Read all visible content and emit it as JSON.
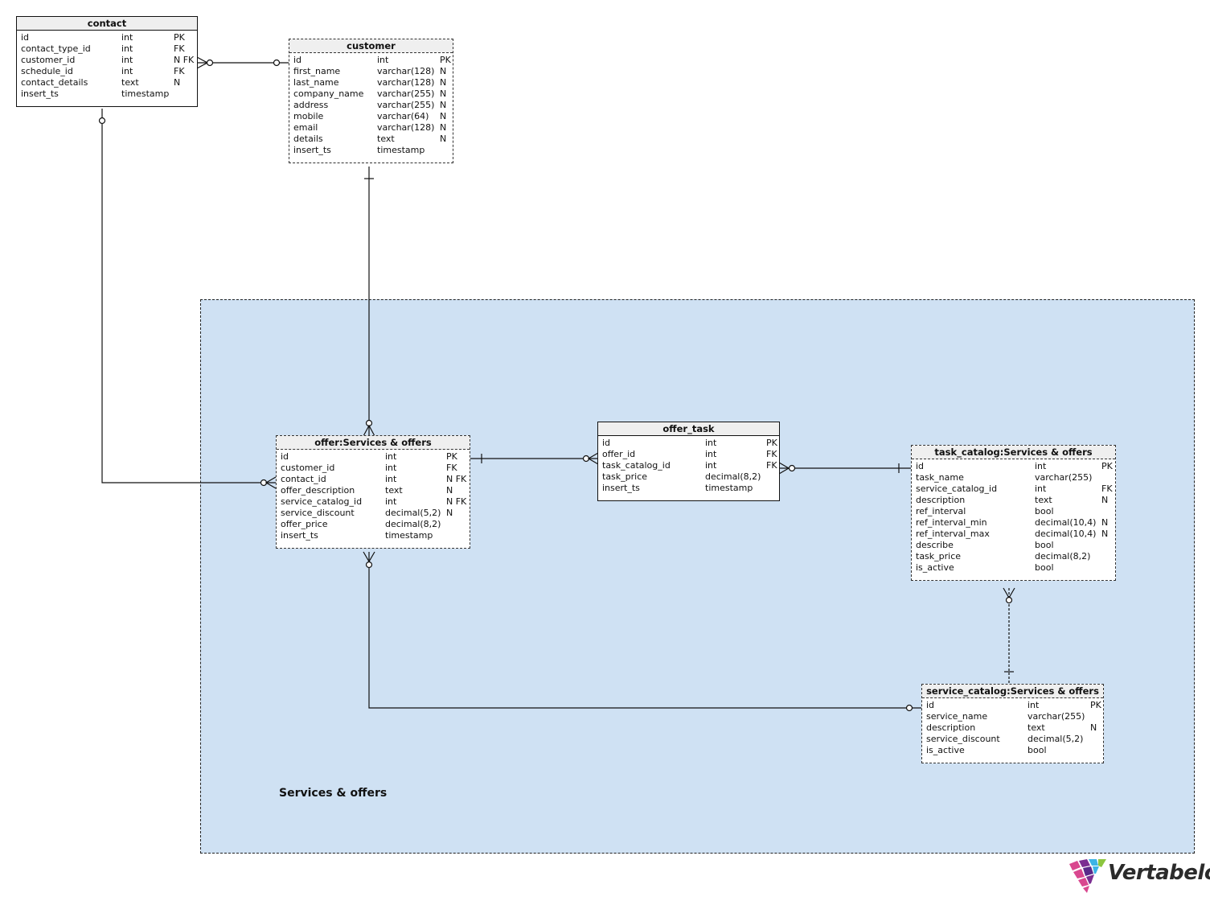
{
  "subject_area": {
    "label": "Services & offers",
    "fill_color": "#cfe1f3"
  },
  "tables": {
    "contact": {
      "title": "contact",
      "columns": [
        {
          "name": "id",
          "type": "int",
          "flags": "PK"
        },
        {
          "name": "contact_type_id",
          "type": "int",
          "flags": "FK"
        },
        {
          "name": "customer_id",
          "type": "int",
          "flags": "N FK"
        },
        {
          "name": "schedule_id",
          "type": "int",
          "flags": "FK"
        },
        {
          "name": "contact_details",
          "type": "text",
          "flags": "N"
        },
        {
          "name": "insert_ts",
          "type": "timestamp",
          "flags": ""
        }
      ]
    },
    "customer": {
      "title": "customer",
      "columns": [
        {
          "name": "id",
          "type": "int",
          "flags": "PK"
        },
        {
          "name": "first_name",
          "type": "varchar(128)",
          "flags": "N"
        },
        {
          "name": "last_name",
          "type": "varchar(128)",
          "flags": "N"
        },
        {
          "name": "company_name",
          "type": "varchar(255)",
          "flags": "N"
        },
        {
          "name": "address",
          "type": "varchar(255)",
          "flags": "N"
        },
        {
          "name": "mobile",
          "type": "varchar(64)",
          "flags": "N"
        },
        {
          "name": "email",
          "type": "varchar(128)",
          "flags": "N"
        },
        {
          "name": "details",
          "type": "text",
          "flags": "N"
        },
        {
          "name": "insert_ts",
          "type": "timestamp",
          "flags": ""
        }
      ]
    },
    "offer": {
      "title": "offer:Services & offers",
      "columns": [
        {
          "name": "id",
          "type": "int",
          "flags": "PK"
        },
        {
          "name": "customer_id",
          "type": "int",
          "flags": "FK"
        },
        {
          "name": "contact_id",
          "type": "int",
          "flags": "N FK"
        },
        {
          "name": "offer_description",
          "type": "text",
          "flags": "N"
        },
        {
          "name": "service_catalog_id",
          "type": "int",
          "flags": "N FK"
        },
        {
          "name": "service_discount",
          "type": "decimal(5,2)",
          "flags": "N"
        },
        {
          "name": "offer_price",
          "type": "decimal(8,2)",
          "flags": ""
        },
        {
          "name": "insert_ts",
          "type": "timestamp",
          "flags": ""
        }
      ]
    },
    "offer_task": {
      "title": "offer_task",
      "columns": [
        {
          "name": "id",
          "type": "int",
          "flags": "PK"
        },
        {
          "name": "offer_id",
          "type": "int",
          "flags": "FK"
        },
        {
          "name": "task_catalog_id",
          "type": "int",
          "flags": "FK"
        },
        {
          "name": "task_price",
          "type": "decimal(8,2)",
          "flags": ""
        },
        {
          "name": "insert_ts",
          "type": "timestamp",
          "flags": ""
        }
      ]
    },
    "task_catalog": {
      "title": "task_catalog:Services & offers",
      "columns": [
        {
          "name": "id",
          "type": "int",
          "flags": "PK"
        },
        {
          "name": "task_name",
          "type": "varchar(255)",
          "flags": ""
        },
        {
          "name": "service_catalog_id",
          "type": "int",
          "flags": "FK"
        },
        {
          "name": "description",
          "type": "text",
          "flags": "N"
        },
        {
          "name": "ref_interval",
          "type": "bool",
          "flags": ""
        },
        {
          "name": "ref_interval_min",
          "type": "decimal(10,4)",
          "flags": "N"
        },
        {
          "name": "ref_interval_max",
          "type": "decimal(10,4)",
          "flags": "N"
        },
        {
          "name": "describe",
          "type": "bool",
          "flags": ""
        },
        {
          "name": "task_price",
          "type": "decimal(8,2)",
          "flags": ""
        },
        {
          "name": "is_active",
          "type": "bool",
          "flags": ""
        }
      ]
    },
    "service_catalog": {
      "title": "service_catalog:Services & offers",
      "columns": [
        {
          "name": "id",
          "type": "int",
          "flags": "PK"
        },
        {
          "name": "service_name",
          "type": "varchar(255)",
          "flags": ""
        },
        {
          "name": "description",
          "type": "text",
          "flags": "N"
        },
        {
          "name": "service_discount",
          "type": "decimal(5,2)",
          "flags": ""
        },
        {
          "name": "is_active",
          "type": "bool",
          "flags": ""
        }
      ]
    }
  },
  "relationships": [
    {
      "from": "contact",
      "to": "customer",
      "from_end": "zero-or-many",
      "to_end": "zero-or-one"
    },
    {
      "from": "offer",
      "to": "customer",
      "from_end": "zero-or-many",
      "to_end": "exactly-one"
    },
    {
      "from": "offer",
      "to": "contact",
      "from_end": "zero-or-many",
      "to_end": "zero-or-one"
    },
    {
      "from": "offer_task",
      "to": "offer",
      "from_end": "zero-or-many",
      "to_end": "exactly-one"
    },
    {
      "from": "offer_task",
      "to": "task_catalog",
      "from_end": "zero-or-many",
      "to_end": "exactly-one"
    },
    {
      "from": "offer",
      "to": "service_catalog",
      "from_end": "zero-or-many",
      "to_end": "zero-or-one"
    },
    {
      "from": "task_catalog",
      "to": "service_catalog",
      "from_end": "zero-or-many",
      "to_end": "exactly-one"
    }
  ],
  "branding": {
    "logo_text": "Vertabelo"
  }
}
